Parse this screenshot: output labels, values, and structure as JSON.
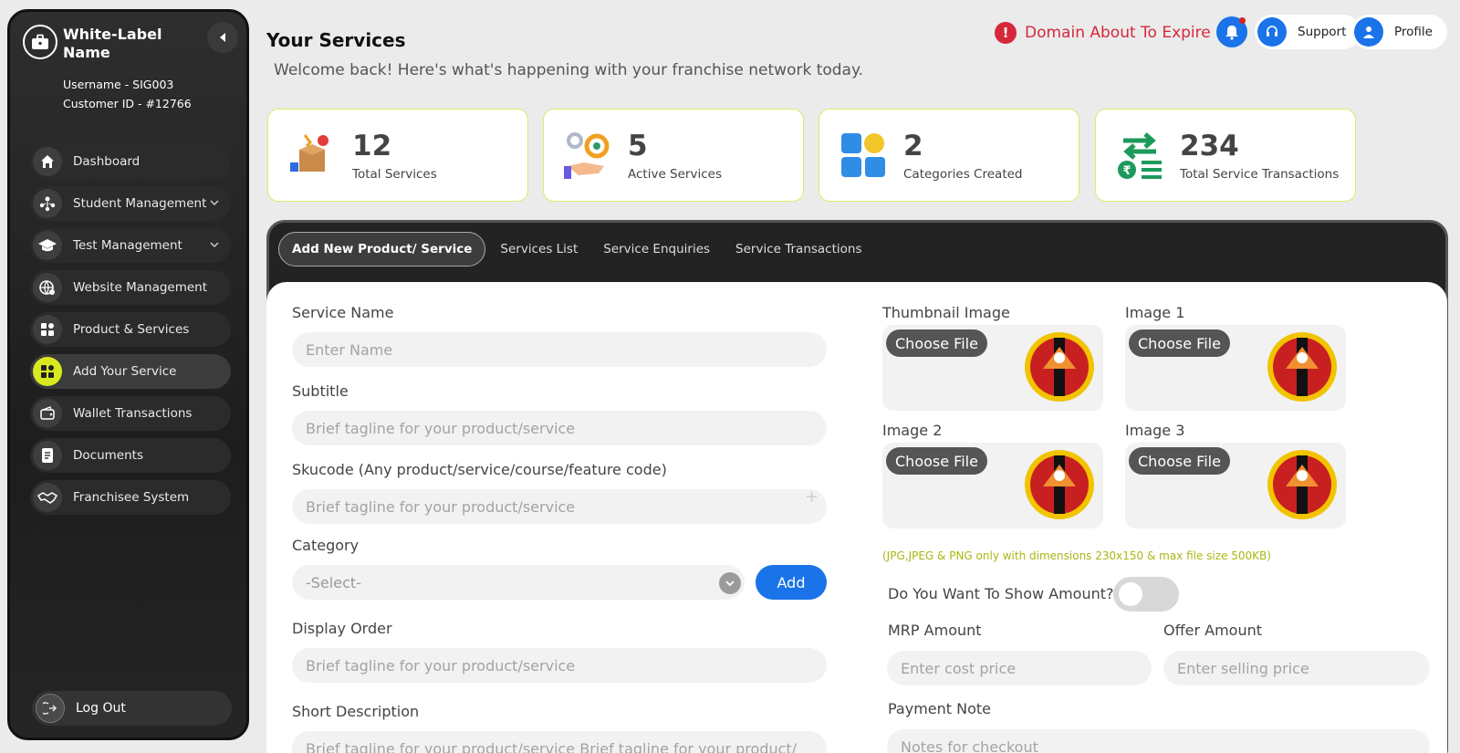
{
  "sidebar": {
    "brand_name": "White-Label Name",
    "username": "Username - SIG003",
    "customer_id": "Customer ID - #12766",
    "items": [
      {
        "label": "Dashboard"
      },
      {
        "label": "Student Management"
      },
      {
        "label": "Test Management"
      },
      {
        "label": "Website Management"
      },
      {
        "label": "Product & Services"
      },
      {
        "label": "Add Your Service"
      },
      {
        "label": "Wallet Transactions"
      },
      {
        "label": "Documents"
      },
      {
        "label": "Franchisee System"
      }
    ],
    "logout": "Log Out"
  },
  "header": {
    "title": "Your Services",
    "subtitle": "Welcome back! Here's what's happening with your franchise network today.",
    "alert": "Domain About To Expire",
    "support": "Support",
    "profile": "Profile"
  },
  "stats": [
    {
      "value": "12",
      "label": "Total Services"
    },
    {
      "value": "5",
      "label": "Active Services"
    },
    {
      "value": "2",
      "label": "Categories Created"
    },
    {
      "value": "234",
      "label": "Total Service Transactions"
    }
  ],
  "tabs": [
    "Add New Product/ Service",
    "Services List",
    "Service Enquiries",
    "Service Transactions"
  ],
  "form": {
    "service_name_label": "Service Name",
    "service_name_placeholder": "Enter Name",
    "subtitle_label": "Subtitle",
    "subtitle_placeholder": "Brief tagline for your product/service",
    "skucode_label": "Skucode (Any product/service/course/feature code)",
    "skucode_placeholder": "Brief tagline for your product/service",
    "category_label": "Category",
    "category_value": "-Select-",
    "add_label": "Add",
    "display_order_label": "Display Order",
    "display_order_placeholder": "Brief tagline for your product/service",
    "short_desc_label": "Short Description",
    "short_desc_placeholder": "Brief tagline for your product/service Brief tagline for your product/",
    "thumbnail_label": "Thumbnail Image",
    "image1_label": "Image 1",
    "image2_label": "Image 2",
    "image3_label": "Image 3",
    "choose_file": "Choose File",
    "hint": "(JPG,JPEG & PNG only with dimensions 230x150 & max file size  500KB)",
    "show_amount_label": "Do You Want To Show Amount?",
    "mrp_label": "MRP Amount",
    "mrp_placeholder": "Enter cost price",
    "offer_label": "Offer Amount",
    "offer_placeholder": "Enter selling price",
    "payment_note_label": "Payment Note",
    "payment_note_placeholder": "Notes for checkout"
  },
  "colors": {
    "accent_blue": "#1a73e8",
    "alert_red": "#d6283a",
    "active_lime": "#d8ea1e",
    "stat_border": "#d9ec6a"
  }
}
